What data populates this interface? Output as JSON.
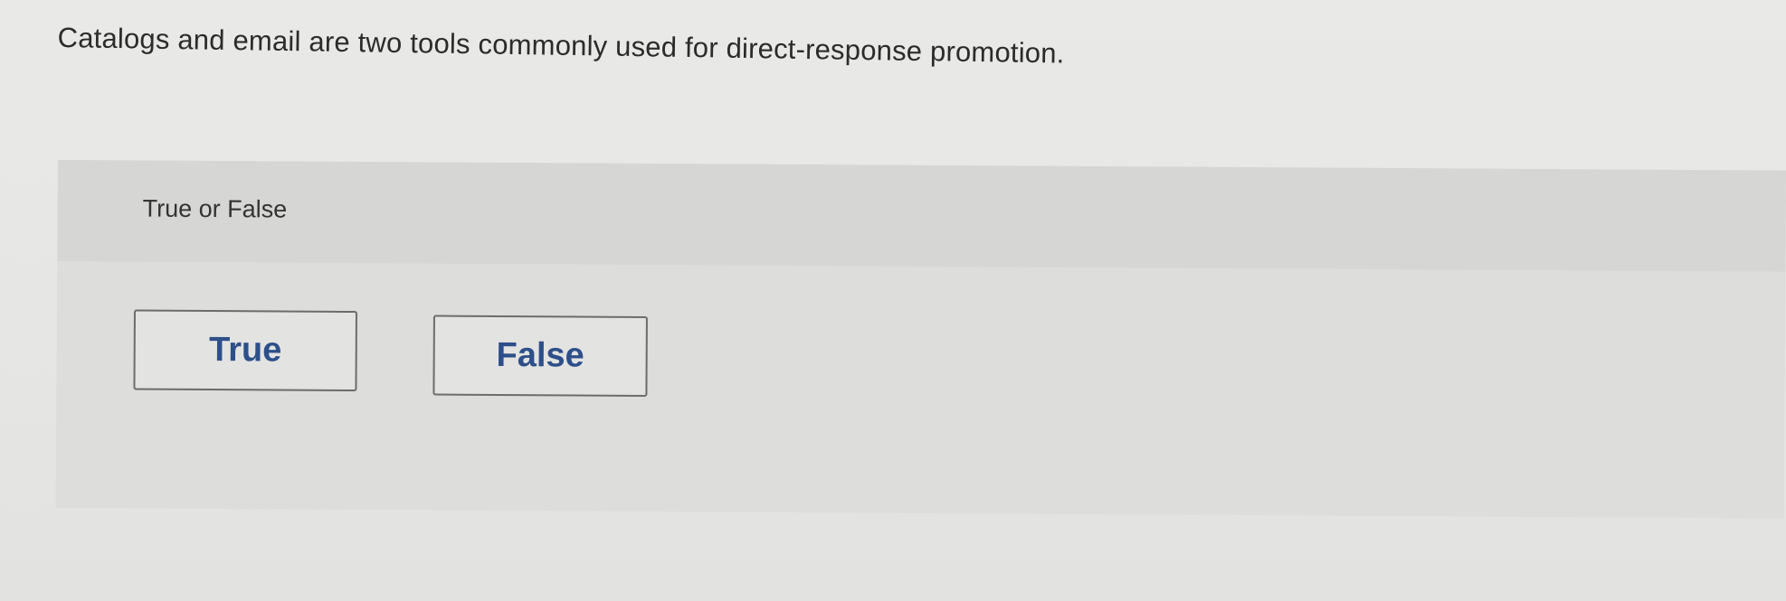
{
  "question": {
    "text": "Catalogs and email are two tools commonly used for direct-response promotion."
  },
  "panel": {
    "label": "True or False",
    "options": [
      {
        "label": "True"
      },
      {
        "label": "False"
      }
    ]
  },
  "colors": {
    "option_text": "#2d4f8a",
    "option_border": "#6c6c6c",
    "panel_background": "#dddddb",
    "panel_header_background": "#d6d6d4"
  }
}
